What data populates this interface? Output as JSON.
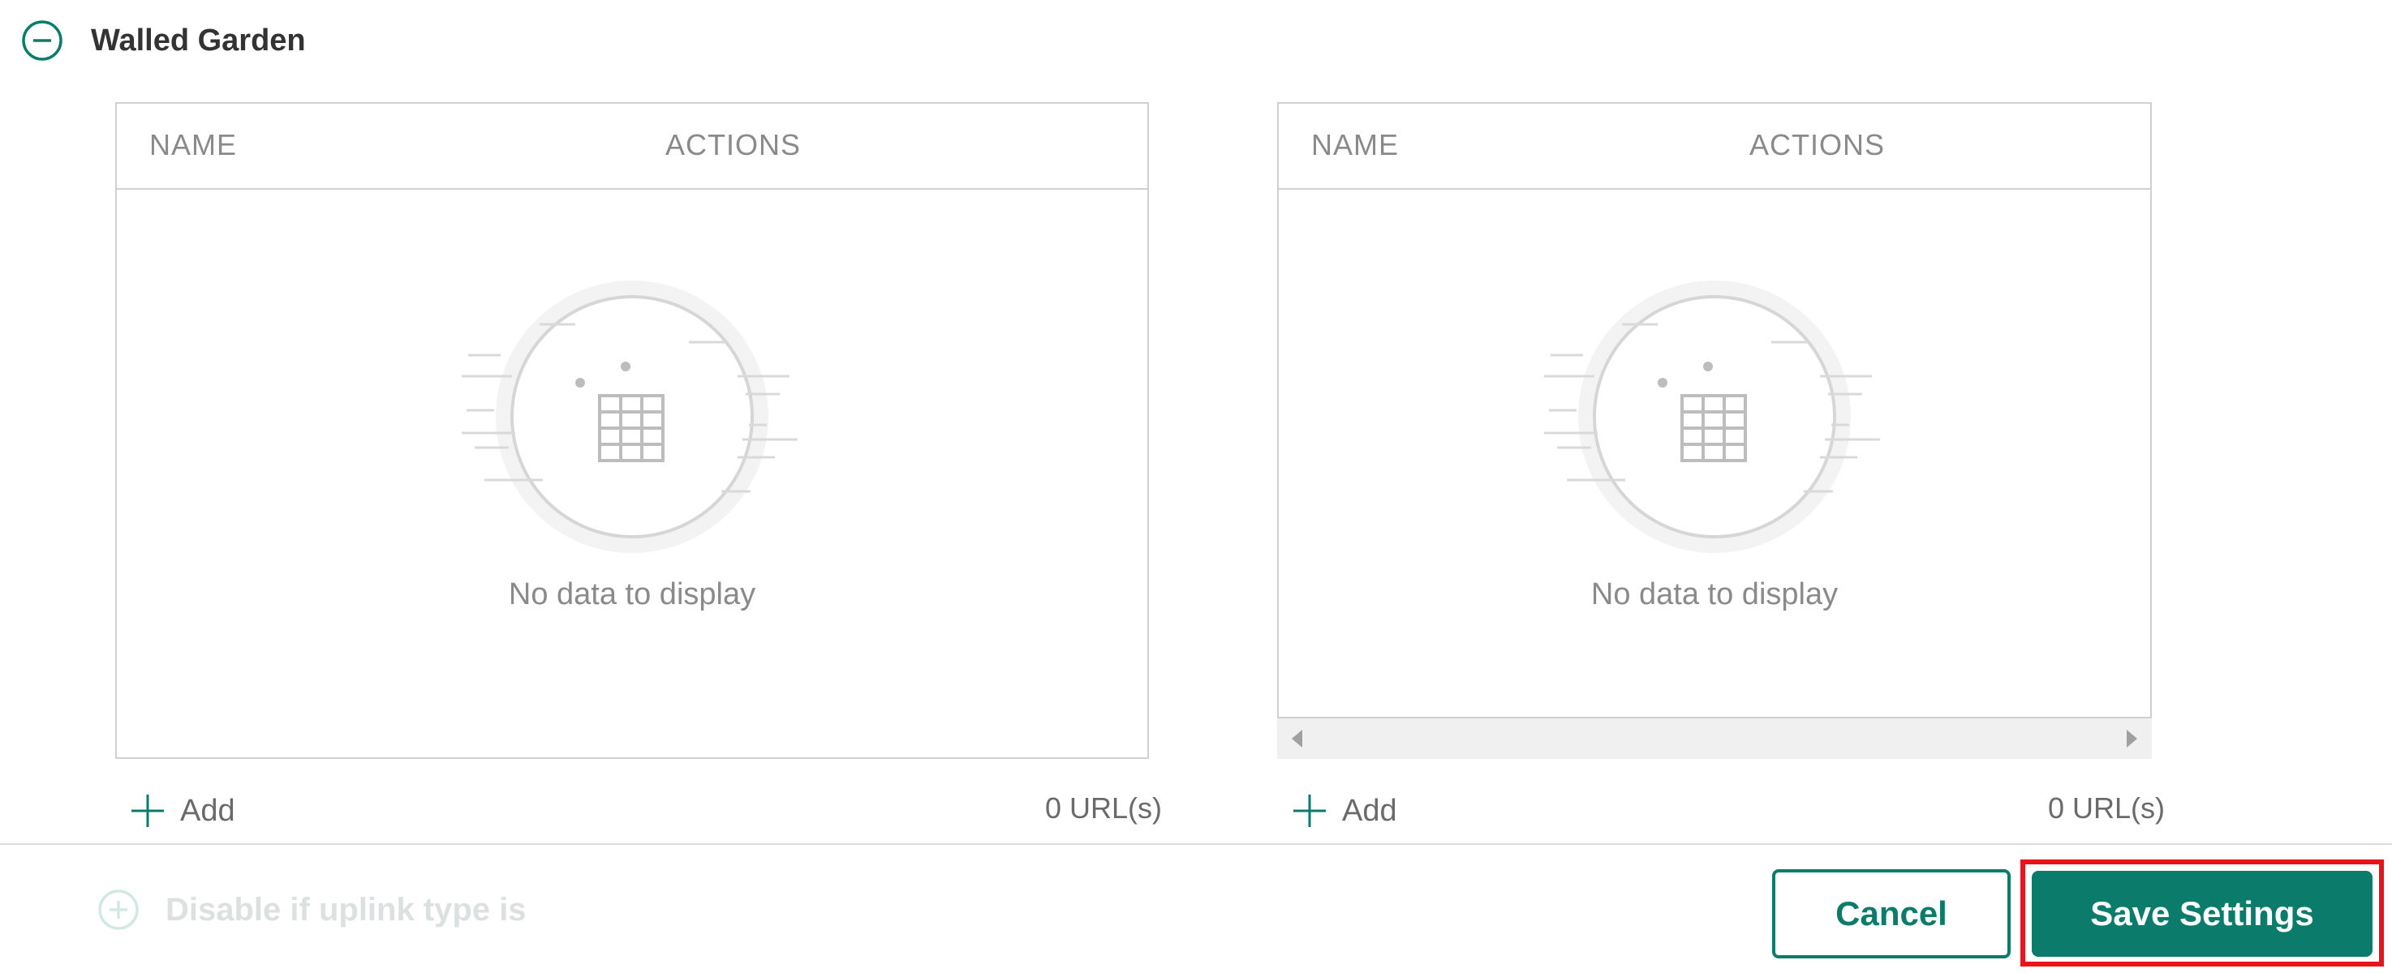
{
  "section": {
    "title": "Walled Garden",
    "collapse_icon": "minus-circle-icon"
  },
  "tables": [
    {
      "columns": [
        "NAME",
        "ACTIONS"
      ],
      "empty_text": "No data to display",
      "add_label": "Add",
      "count_text": "0 URL(s)"
    },
    {
      "columns": [
        "NAME",
        "ACTIONS"
      ],
      "empty_text": "No data to display",
      "add_label": "Add",
      "count_text": "0 URL(s)"
    }
  ],
  "next_section": {
    "title": "Disable if uplink type is",
    "expand_icon": "plus-circle-icon"
  },
  "footer": {
    "cancel_label": "Cancel",
    "save_label": "Save Settings"
  },
  "colors": {
    "accent": "#0b7c6b",
    "highlight": "#e8141c"
  }
}
